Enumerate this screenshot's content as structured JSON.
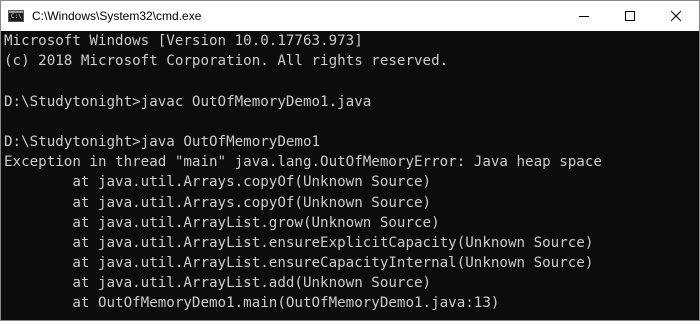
{
  "window": {
    "title": "C:\\Windows\\System32\\cmd.exe",
    "app_icon": "cmd-console-icon",
    "app_icon_glyph": "C:\\",
    "controls": [
      "minimize-icon",
      "maximize-icon",
      "close-icon"
    ]
  },
  "colors": {
    "console_background": "#0c0c0c",
    "console_text": "#cccccc",
    "titlebar_background": "#ffffff"
  },
  "console": {
    "lines": [
      "Microsoft Windows [Version 10.0.17763.973]",
      "(c) 2018 Microsoft Corporation. All rights reserved.",
      "",
      "D:\\Studytonight>javac OutOfMemoryDemo1.java",
      "",
      "D:\\Studytonight>java OutOfMemoryDemo1",
      "Exception in thread \"main\" java.lang.OutOfMemoryError: Java heap space",
      "        at java.util.Arrays.copyOf(Unknown Source)",
      "        at java.util.Arrays.copyOf(Unknown Source)",
      "        at java.util.ArrayList.grow(Unknown Source)",
      "        at java.util.ArrayList.ensureExplicitCapacity(Unknown Source)",
      "        at java.util.ArrayList.ensureCapacityInternal(Unknown Source)",
      "        at java.util.ArrayList.add(Unknown Source)",
      "        at OutOfMemoryDemo1.main(OutOfMemoryDemo1.java:13)"
    ]
  }
}
